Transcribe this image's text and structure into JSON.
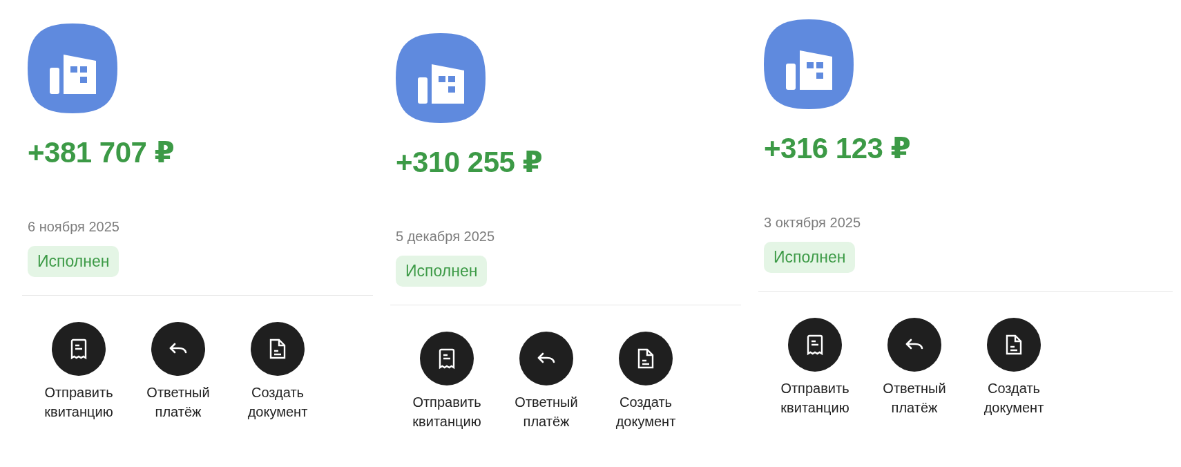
{
  "receipts": [
    {
      "amount": "+381 707 ₽",
      "date": "6 ноября 2025",
      "status": "Исполнен",
      "actions": [
        {
          "kind": "receipt",
          "label": [
            "Отправить",
            "квитанцию"
          ]
        },
        {
          "kind": "reply",
          "label": [
            "Ответный",
            "платёж"
          ]
        },
        {
          "kind": "document",
          "label": [
            "Создать",
            "документ"
          ]
        }
      ]
    },
    {
      "amount": "+310 255 ₽",
      "date": "5 декабря 2025",
      "status": "Исполнен",
      "actions": [
        {
          "kind": "receipt",
          "label": [
            "Отправить",
            "квитанцию"
          ]
        },
        {
          "kind": "reply",
          "label": [
            "Ответный",
            "платёж"
          ]
        },
        {
          "kind": "document",
          "label": [
            "Создать",
            "документ"
          ]
        }
      ]
    },
    {
      "amount": "+316 123 ₽",
      "date": "3 октября 2025",
      "status": "Исполнен",
      "actions": [
        {
          "kind": "receipt",
          "label": [
            "Отправить",
            "квитанцию"
          ]
        },
        {
          "kind": "reply",
          "label": [
            "Ответный",
            "платёж"
          ]
        },
        {
          "kind": "document",
          "label": [
            "Создать",
            "документ"
          ]
        }
      ]
    }
  ]
}
